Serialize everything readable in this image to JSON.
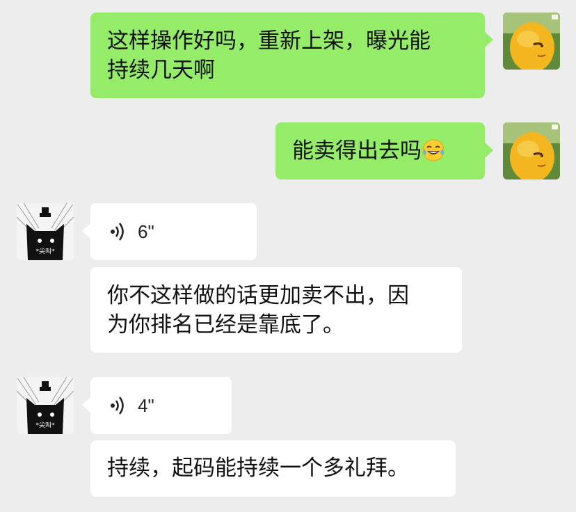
{
  "messages": [
    {
      "side": "right",
      "type": "text",
      "text_lines": [
        "这样操作好吗，重新上架，曝光能",
        "持续几天啊"
      ]
    },
    {
      "side": "right",
      "type": "text",
      "text": "能卖得出去吗",
      "emoji": "tears-of-joy-emoji"
    },
    {
      "side": "left",
      "type": "voice",
      "duration": "6\""
    },
    {
      "side": "left",
      "type": "text",
      "text_lines": [
        "你不这样做的话更加卖不出，因",
        "为你排名已经是靠底了。"
      ]
    },
    {
      "side": "left",
      "type": "voice",
      "duration": "4\""
    },
    {
      "side": "left",
      "type": "text",
      "text": "持续，起码能持续一个多礼拜。"
    }
  ],
  "avatars": {
    "self": {
      "icon": "yellow-character-avatar"
    },
    "contact": {
      "icon": "black-cat-avatar",
      "caption": "*尖叫*"
    }
  },
  "colors": {
    "background": "#ededed",
    "sent_bubble": "#95ec69",
    "received_bubble": "#ffffff"
  }
}
